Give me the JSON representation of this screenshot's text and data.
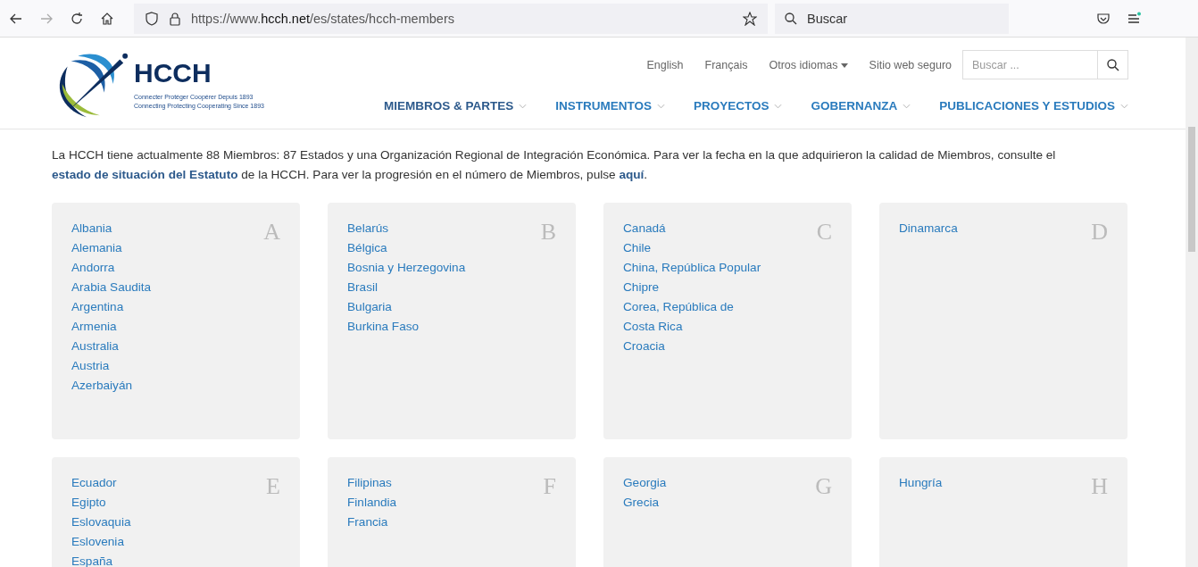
{
  "browser": {
    "url": "https://www.**hcch.net**/es/states/hcch-members",
    "search_placeholder": "Buscar"
  },
  "header": {
    "logo_text": "HCCH",
    "tagline": [
      "Connecter Protéger Coopérer Depuis 1893",
      "Connecting Protecting Cooperating Since 1893"
    ],
    "top_links": [
      {
        "label": "English",
        "kind": "link"
      },
      {
        "label": "Français",
        "kind": "link"
      },
      {
        "label": "Otros idiomas",
        "kind": "dropdown"
      },
      {
        "label": "Sitio web seguro",
        "kind": "link"
      }
    ],
    "search_placeholder": "Buscar ...",
    "nav": [
      "MIEMBROS & PARTES",
      "INSTRUMENTOS",
      "PROYECTOS",
      "GOBERNANZA",
      "PUBLICACIONES Y ESTUDIOS"
    ]
  },
  "intro": [
    {
      "kind": "text",
      "text": "La HCCH tiene actualmente 88 Miembros: 87 Estados y una Organización Regional de Integración Económica. Para ver la fecha en la que adquirieron la calidad de Miembros, consulte el "
    },
    {
      "kind": "link",
      "text": "estado de situación del Estatuto"
    },
    {
      "kind": "text",
      "text": " de la HCCH. Para ver la progresión en el número de Miembros, pulse "
    },
    {
      "kind": "link",
      "text": "aquí"
    },
    {
      "kind": "text",
      "text": "."
    }
  ],
  "groups": [
    {
      "letter": "A",
      "members": [
        "Albania",
        "Alemania",
        "Andorra",
        "Arabia Saudita",
        "Argentina",
        "Armenia",
        "Australia",
        "Austria",
        "Azerbaiyán"
      ]
    },
    {
      "letter": "B",
      "members": [
        "Belarús",
        "Bélgica",
        "Bosnia y Herzegovina",
        "Brasil",
        "Bulgaria",
        "Burkina Faso"
      ]
    },
    {
      "letter": "C",
      "members": [
        "Canadá",
        "Chile",
        "China, República Popular",
        "Chipre",
        "Corea, República de",
        "Costa Rica",
        "Croacia"
      ]
    },
    {
      "letter": "D",
      "members": [
        "Dinamarca"
      ]
    },
    {
      "letter": "E",
      "members": [
        "Ecuador",
        "Egipto",
        "Eslovaquia",
        "Eslovenia",
        "España"
      ]
    },
    {
      "letter": "F",
      "members": [
        "Filipinas",
        "Finlandia",
        "Francia"
      ]
    },
    {
      "letter": "G",
      "members": [
        "Georgia",
        "Grecia"
      ]
    },
    {
      "letter": "H",
      "members": [
        "Hungría"
      ]
    }
  ]
}
